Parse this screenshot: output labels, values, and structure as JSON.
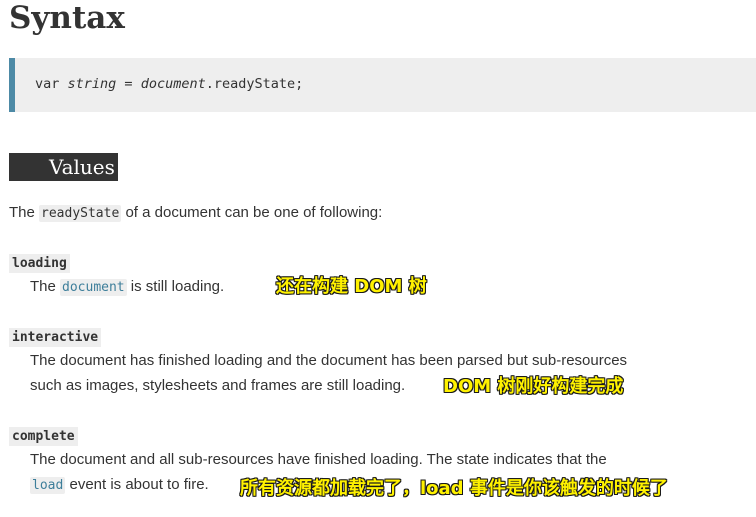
{
  "heading": "Syntax",
  "code": {
    "var_kw": "var ",
    "var_name": "string",
    "rest": " = ",
    "obj": "document",
    "prop": ".readyState;"
  },
  "values_heading": "Values",
  "intro": {
    "before": "The ",
    "code": "readyState",
    "after": " of a document can be one of following:"
  },
  "states": [
    {
      "term": "loading",
      "line1_before": "The ",
      "line1_code": "document",
      "line1_after": " is still loading.",
      "annotation": "还在构建 DOM 树"
    },
    {
      "term": "interactive",
      "line1": "The document has finished loading and the document has been parsed but sub-resources",
      "line2": "such as images, stylesheets and frames are still loading.",
      "annotation": "DOM 树刚好构建完成"
    },
    {
      "term": "complete",
      "line1": "The document and all sub-resources have finished loading. The state indicates that the",
      "line2_code": "load",
      "line2_after": " event is about to fire.",
      "annotation": "所有资源都加载完了，load 事件是你该触发的时候了"
    }
  ],
  "colors": {
    "accent_border": "#4d8aa6",
    "link_code": "#3d7e9a",
    "annotation_text": "#fff200"
  }
}
